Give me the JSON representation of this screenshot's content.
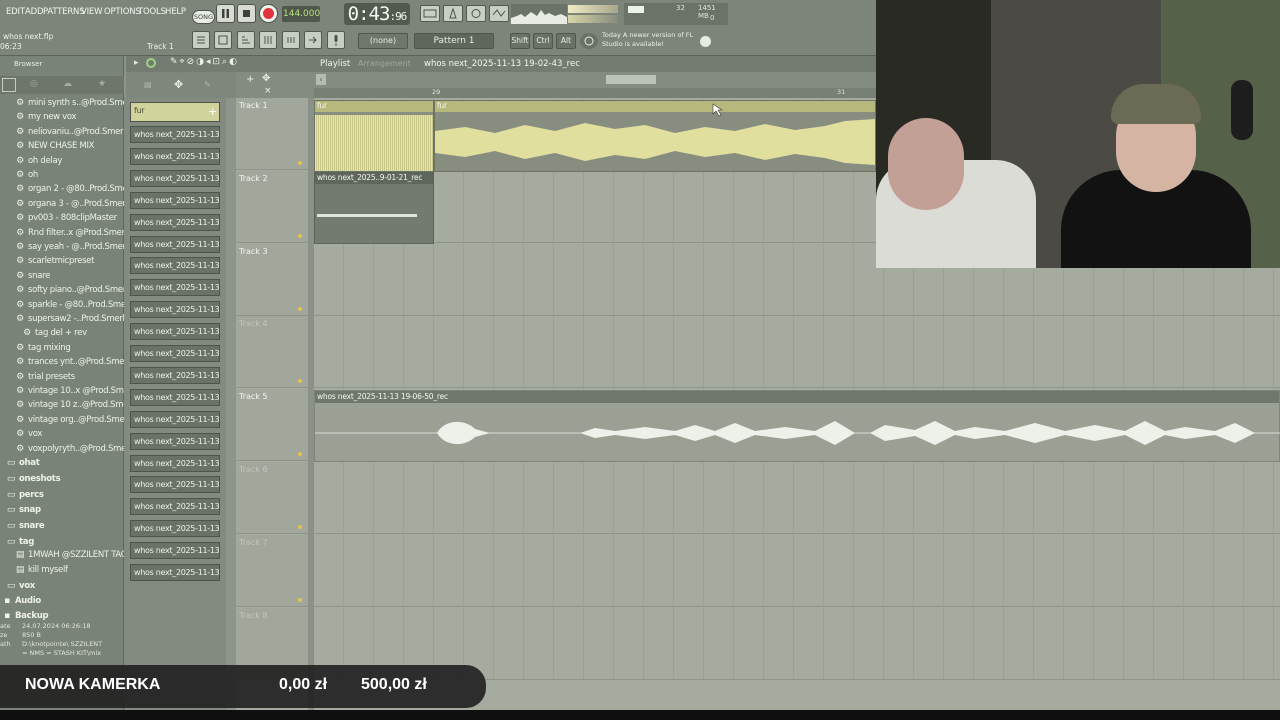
{
  "menu": {
    "items": [
      "EDIT",
      "ADD",
      "PATTERNS",
      "VIEW",
      "OPTIONS",
      "TOOLS",
      "HELP"
    ],
    "project_hint": "whos next.flp",
    "project_time": "06:23",
    "track_hint": "Track 1"
  },
  "transport": {
    "mode": "SONG",
    "tempo": "144.000",
    "time_main": "0:43",
    "time_sub": "96",
    "cpu_value": "32",
    "mem_value": "1451 MB",
    "poly_value": "0"
  },
  "toolbar2": {
    "snap": "(none)",
    "pattern": "Pattern 1",
    "shift_label": "Shift",
    "ctrl_label": "Ctrl",
    "alt_label": "Alt",
    "news_title": "Today",
    "news_text": "A newer version of FL Studio is available!"
  },
  "browser": {
    "title": "Browser",
    "items": [
      {
        "label": "mini synth s..@Prod.Smerk",
        "icon": "gear-icon"
      },
      {
        "label": "my new vox",
        "icon": "gear-icon"
      },
      {
        "label": "neliovaniu..@Prod.Smerk",
        "icon": "gear-icon"
      },
      {
        "label": "NEW CHASE MIX",
        "icon": "gear-icon"
      },
      {
        "label": "oh delay",
        "icon": "gear-icon"
      },
      {
        "label": "oh",
        "icon": "gear-icon"
      },
      {
        "label": "organ 2 - @80..Prod.Smerk",
        "icon": "gear-icon"
      },
      {
        "label": "organa 3 - @..Prod.Smerk",
        "icon": "gear-icon"
      },
      {
        "label": "pv003 - 808clipMaster",
        "icon": "gear-icon"
      },
      {
        "label": "Rnd filter..x @Prod.Smerk",
        "icon": "gear-icon"
      },
      {
        "label": "say yeah - @..Prod.Smerk",
        "icon": "gear-icon"
      },
      {
        "label": "scarletmicpreset",
        "icon": "gear-icon"
      },
      {
        "label": "snare",
        "icon": "gear-icon"
      },
      {
        "label": "softy piano..@Prod.Smerk",
        "icon": "gear-icon"
      },
      {
        "label": "sparkle - @80..Prod.Smerk",
        "icon": "gear-icon"
      },
      {
        "label": "supersaw2 -..Prod.Smerk",
        "icon": "gear-icon"
      },
      {
        "label": "tag del + rev",
        "icon": "gear-icon"
      },
      {
        "label": "tag mixing",
        "icon": "gear-icon"
      },
      {
        "label": "trances ynt..@Prod.Smerk",
        "icon": "gear-icon"
      },
      {
        "label": "trial presets",
        "icon": "gear-icon"
      },
      {
        "label": "vintage 10..x @Prod.Smerk",
        "icon": "gear-icon"
      },
      {
        "label": "vintage 10 z..@Prod.Smerk",
        "icon": "gear-icon"
      },
      {
        "label": "vintage org..@Prod.Smerk",
        "icon": "gear-icon"
      },
      {
        "label": "vox",
        "icon": "gear-icon"
      },
      {
        "label": "voxpolyryth..@Prod.Smerk",
        "icon": "gear-icon"
      }
    ],
    "folders": [
      {
        "label": "ohat"
      },
      {
        "label": "oneshots"
      },
      {
        "label": "percs"
      },
      {
        "label": "snap"
      },
      {
        "label": "snare"
      },
      {
        "label": "tag"
      }
    ],
    "tag_files": [
      "1MWAH @SZZILENT TAG",
      "kill myself"
    ],
    "root_folders": [
      {
        "label": "vox"
      },
      {
        "label": "Audio"
      },
      {
        "label": "Backup"
      }
    ],
    "info": {
      "date_label": "ate",
      "date": "24.07.2024 06:26:18",
      "size_label": "ze",
      "size": "850 B",
      "path_label": "ath",
      "path": "D:\\knotpointe\\ SZZILENT",
      "path2": "= NMS = STASH KIT\\mix"
    }
  },
  "channels": {
    "first": "fur",
    "items": [
      "whos next_2025-11-13 1..",
      "whos next_2025-11-13 1..",
      "whos next_2025-11-13 1..",
      "whos next_2025-11-13 1..",
      "whos next_2025-11-13 1..",
      "whos next_2025-11-13 1..",
      "whos next_2025-11-13 1..",
      "whos next_2025-11-13 1..",
      "whos next_2025-11-13 1..",
      "whos next_2025-11-13 1..",
      "whos next_2025-11-13 1..",
      "whos next_2025-11-13 1..",
      "whos next_2025-11-13 1..",
      "whos next_2025-11-13 1..",
      "whos next_2025-11-13 1..",
      "whos next_2025-11-13 1..",
      "whos next_2025-11-13 1..",
      "whos next_2025-11-13 1..",
      "whos next_2025-11-13 1..",
      "whos next_2025-11-13 1..",
      "whos next_2025-11-13 1.."
    ]
  },
  "playlist": {
    "title": "Playlist",
    "arrangement": "Arrangement",
    "selected_clip": "whos next_2025-11-13 19-02-43_rec",
    "bar_markers": [
      "29",
      "31"
    ],
    "tracks": [
      {
        "label": "Track 1"
      },
      {
        "label": "Track 2"
      },
      {
        "label": "Track 3"
      },
      {
        "label": "Track 4"
      },
      {
        "label": "Track 5"
      },
      {
        "label": "Track 6"
      },
      {
        "label": "Track 7"
      },
      {
        "label": "Track 8"
      }
    ],
    "clips": {
      "track1_a": "fur",
      "track1_b": "fur",
      "track2": "whos next_2025..9-01-21_rec",
      "track5": "whos next_2025-11-13 19-06-50_rec"
    }
  },
  "overlay": {
    "title": "NOWA KAMERKA",
    "current": "0,00 zł",
    "goal": "500,00 zł"
  },
  "colors": {
    "accent_yellow": "#e4e2a0",
    "record_red": "#e0343a",
    "background": "#8d948b"
  }
}
